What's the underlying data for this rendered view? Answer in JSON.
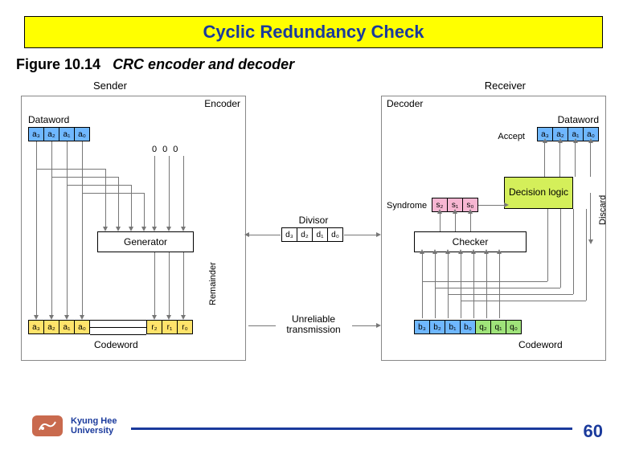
{
  "title": "Cyclic Redundancy Check",
  "figure": {
    "number": "Figure 10.14",
    "title": "CRC encoder and decoder"
  },
  "diagram": {
    "sender_label": "Sender",
    "receiver_label": "Receiver",
    "encoder_label": "Encoder",
    "decoder_label": "Decoder",
    "dataword_label": "Dataword",
    "codeword_label": "Codeword",
    "generator_label": "Generator",
    "checker_label": "Checker",
    "decision_label": "Decision logic",
    "accept_label": "Accept",
    "discard_label": "Discard",
    "syndrome_label": "Syndrome",
    "remainder_label": "Remainder",
    "divisor_label": "Divisor",
    "unreliable_label": "Unreliable transmission",
    "zeros": [
      "0",
      "0",
      "0"
    ],
    "a": [
      "a₃",
      "a₂",
      "a₁",
      "a₀"
    ],
    "r": [
      "r₂",
      "r₁",
      "r₀"
    ],
    "d": [
      "d₃",
      "d₂",
      "d₁",
      "d₀"
    ],
    "s": [
      "s₂",
      "s₁",
      "s₀"
    ],
    "b": [
      "b₃",
      "b₂",
      "b₁",
      "b₀"
    ],
    "q": [
      "q₂",
      "q₁",
      "q₀"
    ]
  },
  "footer": {
    "institution_line1": "Kyung Hee",
    "institution_line2": "University",
    "page": "60"
  },
  "chart_data": {
    "type": "table",
    "title": "CRC encoder and decoder block diagram",
    "blocks": {
      "sender": {
        "dataword": [
          "a3",
          "a2",
          "a1",
          "a0"
        ],
        "appended_zeros": [
          "0",
          "0",
          "0"
        ],
        "generator_input_bits": 7,
        "generator": "Generator",
        "remainder": [
          "r2",
          "r1",
          "r0"
        ],
        "codeword": [
          "a3",
          "a2",
          "a1",
          "a0",
          "r2",
          "r1",
          "r0"
        ]
      },
      "divisor": [
        "d3",
        "d2",
        "d1",
        "d0"
      ],
      "channel": "Unreliable transmission",
      "receiver": {
        "received_codeword": [
          "b3",
          "b2",
          "b1",
          "b0",
          "q2",
          "q1",
          "q0"
        ],
        "checker": "Checker",
        "syndrome": [
          "s2",
          "s1",
          "s0"
        ],
        "decision_logic": "Decision logic",
        "outputs": {
          "accept_dataword": [
            "a3",
            "a2",
            "a1",
            "a0"
          ],
          "discard": true
        }
      }
    }
  }
}
